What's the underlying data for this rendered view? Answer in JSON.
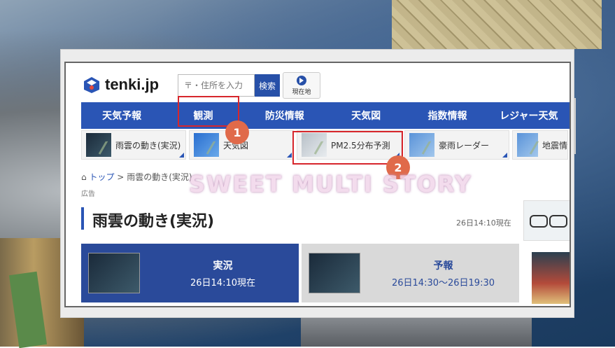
{
  "site": {
    "logo_text": "tenki.jp"
  },
  "search": {
    "placeholder": "〒・住所を入力",
    "button_label": "検索",
    "location_label": "現在地"
  },
  "nav": {
    "items": [
      "天気予報",
      "観測",
      "防災情報",
      "天気図",
      "指数情報",
      "レジャー天気"
    ]
  },
  "subnav": {
    "items": [
      "雨雲の動き(実況)",
      "天気図",
      "PM2.5分布予測",
      "豪雨レーダー",
      "地震情"
    ]
  },
  "breadcrumb": {
    "home": "トップ",
    "sep": ">",
    "current": "雨雲の動き(実況)"
  },
  "ad_label": "広告",
  "page": {
    "title": "雨雲の動き(実況)",
    "timestamp": "26日14:10現在"
  },
  "tabs": [
    {
      "title": "実況",
      "sub": "26日14:10現在"
    },
    {
      "title": "予報",
      "sub": "26日14:30〜26日19:30"
    }
  ],
  "annotations": {
    "badge1": "1",
    "badge2": "2",
    "watermark": "SWEET MULTI STORY"
  },
  "colors": {
    "nav": "#2a55b5",
    "highlight": "#d7262c",
    "badge": "#e06a4a",
    "tab_active": "#2a4a9a"
  }
}
